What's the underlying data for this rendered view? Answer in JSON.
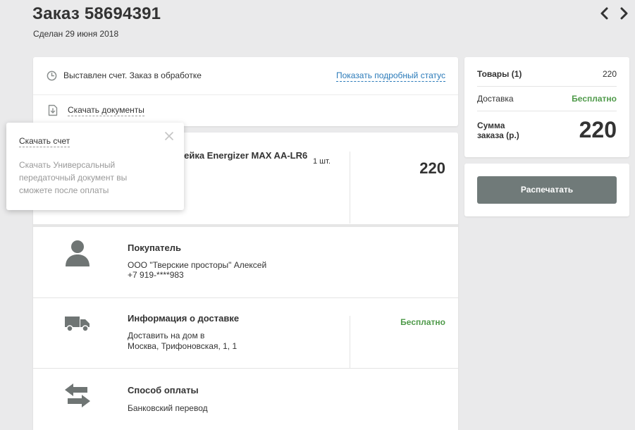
{
  "header": {
    "title": "Заказ 58694391",
    "date": "Сделан 29 июня 2018"
  },
  "status": {
    "text": "Выставлен счет. Заказ в обработке",
    "details_link": "Показать подробный статус",
    "download_docs": "Скачать документы"
  },
  "popover": {
    "title": "Скачать счет",
    "text": "Скачать Универсальный передаточный документ вы сможете после оплаты"
  },
  "product": {
    "name": "Батарейка Energizer MAX AA-LR6",
    "quantity": "1 шт.",
    "price": "220"
  },
  "buyer": {
    "title": "Покупатель",
    "company": "ООО \"Тверские просторы\" Алексей",
    "phone": "+7 919-****983"
  },
  "delivery": {
    "title": "Информация о доставке",
    "method": "Доставить на дом в",
    "address": "Москва, Трифоновская, 1, 1",
    "price": "Бесплатно"
  },
  "payment": {
    "title": "Способ оплаты",
    "method": "Банковский перевод"
  },
  "summary": {
    "goods_label": "Товары (1)",
    "goods_value": "220",
    "shipping_label": "Доставка",
    "shipping_value": "Бесплатно",
    "total_label": "Сумма заказа (р.)",
    "total_value": "220"
  },
  "actions": {
    "print": "Распечатать"
  },
  "icons": {
    "nav_prev": "chevron-left-icon",
    "nav_next": "chevron-right-icon",
    "status": "clock-icon",
    "documents": "document-download-icon",
    "close": "close-icon",
    "buyer": "user-icon",
    "delivery": "truck-icon",
    "payment": "transfer-arrows-icon"
  },
  "colors": {
    "background": "#eaeaeb",
    "link": "#2a7ab9",
    "free": "#4f9a4a",
    "button": "#707a79",
    "icon": "#6f7574"
  }
}
